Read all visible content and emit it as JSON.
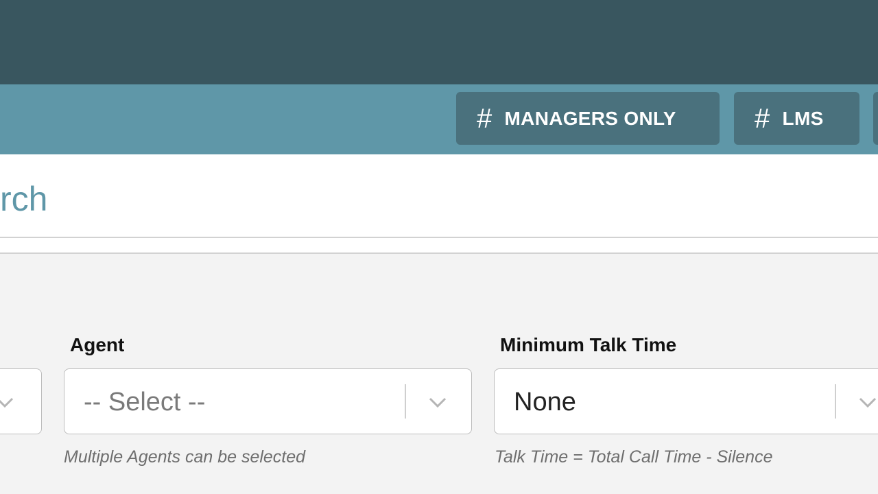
{
  "nav": {
    "chips": [
      {
        "icon": "hash-icon",
        "glyph": "#",
        "label": "MANAGERS ONLY"
      },
      {
        "icon": "hash-icon",
        "glyph": "#",
        "label": "LMS"
      }
    ]
  },
  "page": {
    "title": "rch"
  },
  "filters": {
    "agent": {
      "label": "Agent",
      "value": "-- Select --",
      "helper": "Multiple Agents can be selected"
    },
    "min_talk_time": {
      "label": "Minimum Talk Time",
      "value": "None",
      "helper": "Talk Time = Total Call Time - Silence"
    }
  },
  "colors": {
    "topbar": "#39565f",
    "navbar": "#5f97a8",
    "chip": "#4a717d",
    "title": "#5f97a8",
    "background": "#f3f3f3"
  }
}
